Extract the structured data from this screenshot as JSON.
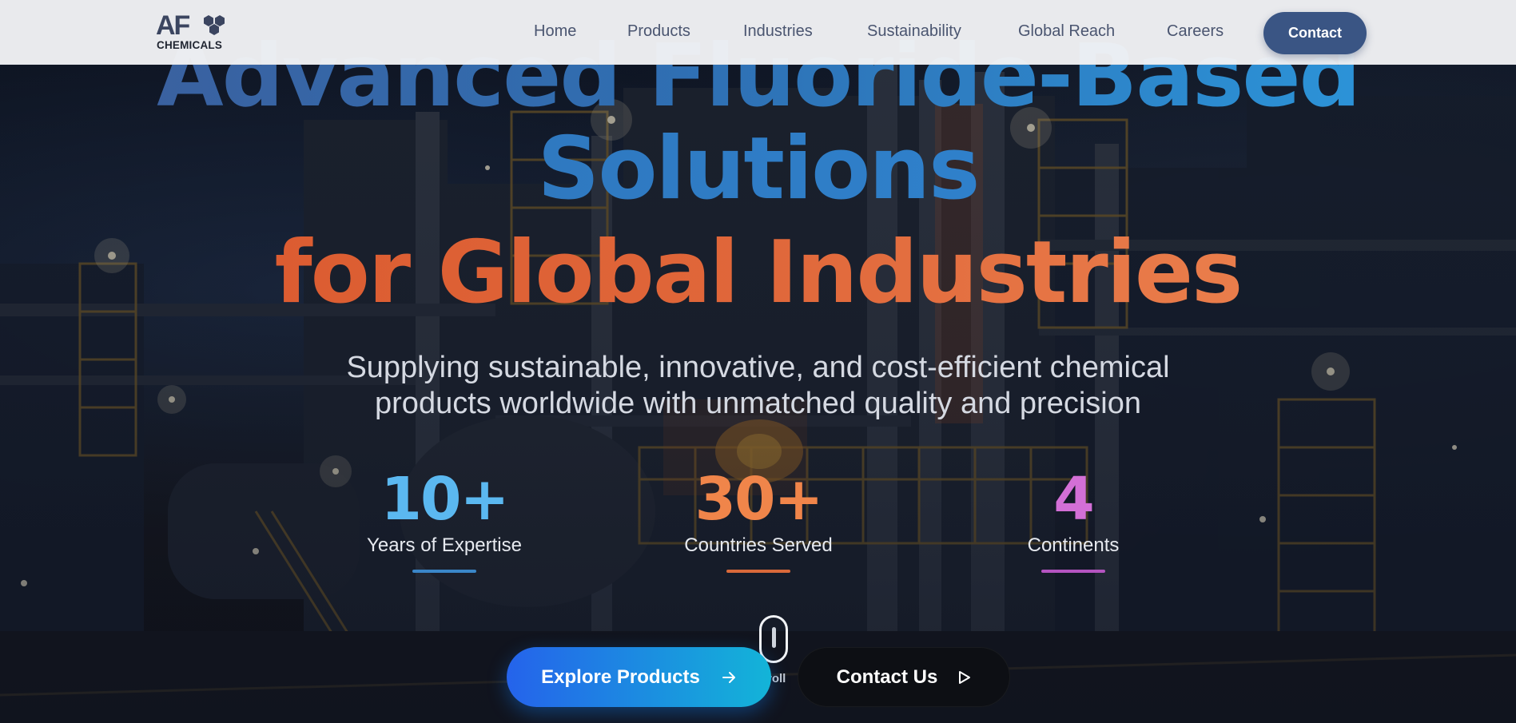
{
  "nav": {
    "logo": {
      "letters": "AF",
      "sub": "CHEMICALS"
    },
    "links": [
      "Home",
      "Products",
      "Industries",
      "Sustainability",
      "Global Reach",
      "Careers"
    ],
    "contact_label": "Contact"
  },
  "hero": {
    "headline_line1": "Advanced Fluoride-Based",
    "headline_line2": "Solutions",
    "headline_line3": "for Global Industries",
    "subtitle_line1": "Supplying sustainable, innovative, and cost-efficient chemical",
    "subtitle_line2": "products worldwide with unmatched quality and precision",
    "stats": [
      {
        "value": "10+",
        "label": "Years of Expertise",
        "color": "#5bb8f0",
        "bar_color": "#3a86c8"
      },
      {
        "value": "30+",
        "label": "Countries Served",
        "color": "#f0854a",
        "bar_color": "#d9693a"
      },
      {
        "value": "4",
        "label": "Continents",
        "color": "#d36fd6",
        "bar_color": "#b454c0"
      }
    ],
    "scroll_text": "roll",
    "explore_label": "Explore Products",
    "contact_label": "Contact Us"
  },
  "colors": {
    "nav_bg": "#f1f2f4",
    "nav_contact_bg": "#3a5584",
    "headline_blue": "#2f8ad8",
    "headline_orange": "#e0673a"
  },
  "icons": {
    "logo": "hexagon-cluster-icon",
    "explore_arrow": "arrow-right-icon",
    "contact_play": "play-outline-icon",
    "scroll": "mouse-scroll-icon"
  }
}
